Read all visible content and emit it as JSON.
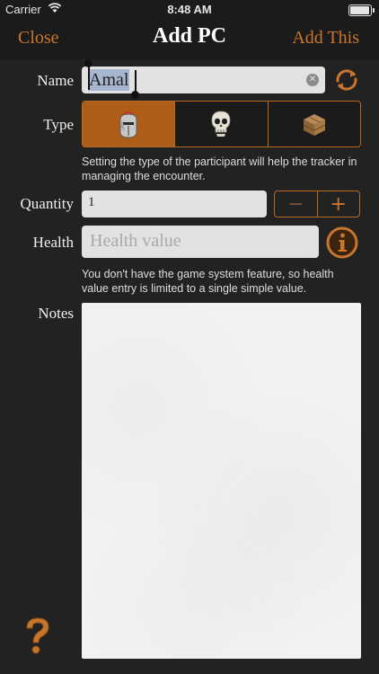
{
  "status_bar": {
    "carrier": "Carrier",
    "time": "8:48 AM",
    "battery_level": 1.0
  },
  "nav": {
    "close_label": "Close",
    "title": "Add PC",
    "add_label": "Add This"
  },
  "form": {
    "name_label": "Name",
    "name_value": "Amal",
    "type_label": "Type",
    "type_options": [
      {
        "icon": "knight-helmet-icon",
        "selected": true
      },
      {
        "icon": "skull-icon",
        "selected": false
      },
      {
        "icon": "crate-icon",
        "selected": false
      }
    ],
    "type_hint": "Setting the type of the participant will help the tracker in managing the encounter.",
    "quantity_label": "Quantity",
    "quantity_value": "1",
    "stepper_minus": "−",
    "stepper_plus": "+",
    "health_label": "Health",
    "health_placeholder": "Health value",
    "health_hint": "You don't have the game system feature, so health value entry is limited to a single simple value.",
    "notes_label": "Notes"
  },
  "colors": {
    "accent": "#c8762d",
    "selected_segment": "#ad5d18",
    "background": "#222222"
  }
}
